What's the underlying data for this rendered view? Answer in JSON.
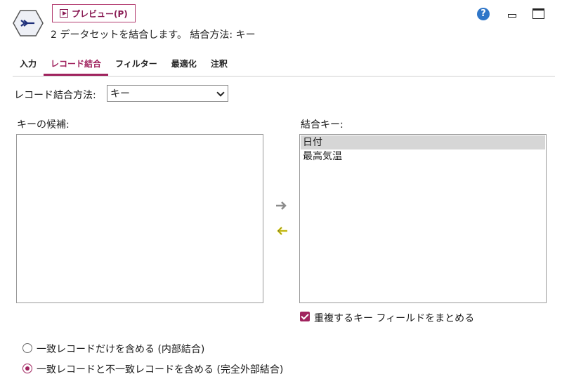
{
  "header": {
    "preview_label": "プレビュー(P)",
    "subtitle": "2 データセットを結合します。 結合方法: キー",
    "help_glyph": "?"
  },
  "tabs": [
    {
      "label": "入力",
      "active": false
    },
    {
      "label": "レコード結合",
      "active": true
    },
    {
      "label": "フィルター",
      "active": false
    },
    {
      "label": "最適化",
      "active": false
    },
    {
      "label": "注釈",
      "active": false
    }
  ],
  "method": {
    "label": "レコード結合方法:",
    "value": "キー"
  },
  "candidates": {
    "label": "キーの候補:",
    "items": []
  },
  "join_keys": {
    "label": "結合キー:",
    "items": [
      {
        "label": "日付",
        "selected": true
      },
      {
        "label": "最高気温",
        "selected": false
      }
    ]
  },
  "combine_duplicates": {
    "label": "重複するキー フィールドをまとめる",
    "checked": true
  },
  "join_type": {
    "options": [
      {
        "label": "一致レコードだけを含める (内部結合)",
        "selected": false
      },
      {
        "label": "一致レコードと不一致レコードを含める (完全外部結合)",
        "selected": true
      }
    ]
  },
  "colors": {
    "accent": "#a0235e",
    "arrow_add": "#8c8c8c",
    "arrow_remove": "#e6d800",
    "help": "#2f76c8"
  }
}
